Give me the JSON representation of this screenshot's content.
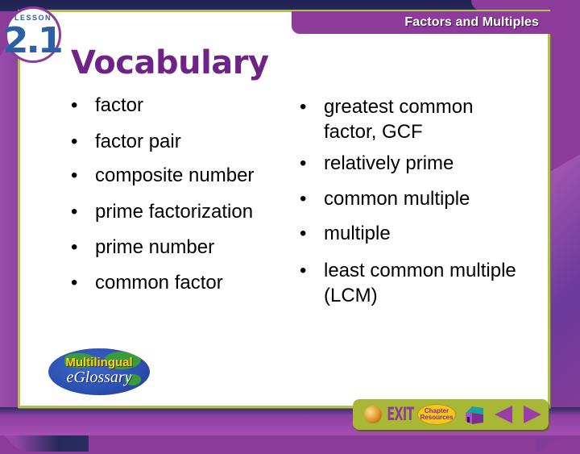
{
  "header": {
    "title": "Factors and Multiples"
  },
  "lesson": {
    "label": "LESSON",
    "number": "2.1"
  },
  "page": {
    "title": "Vocabulary"
  },
  "vocabulary": {
    "left": [
      "factor",
      "factor pair",
      "composite number",
      "prime factorization",
      "prime number",
      "common factor"
    ],
    "right": [
      "greatest common factor, GCF",
      "relatively prime",
      "common multiple",
      "multiple",
      "least common multiple (LCM)"
    ]
  },
  "glossary": {
    "line1": "Multilingual",
    "line2": "eGlossary"
  },
  "toolbar": {
    "exit_label": "EXIT",
    "chapter_line1": "Chapter",
    "chapter_line2": "Resources",
    "icons": [
      "web-globe-icon",
      "exit-icon",
      "chapter-resources-icon",
      "home-icon",
      "previous-arrow-icon",
      "next-arrow-icon"
    ]
  },
  "colors": {
    "brand_purple": "#8e3c9a",
    "title_purple": "#6e2486",
    "lesson_blue": "#2c5fa8",
    "frame_olive": "#b5bf52",
    "toolbar_green": "#a8b836",
    "navy": "#1f1f52"
  }
}
